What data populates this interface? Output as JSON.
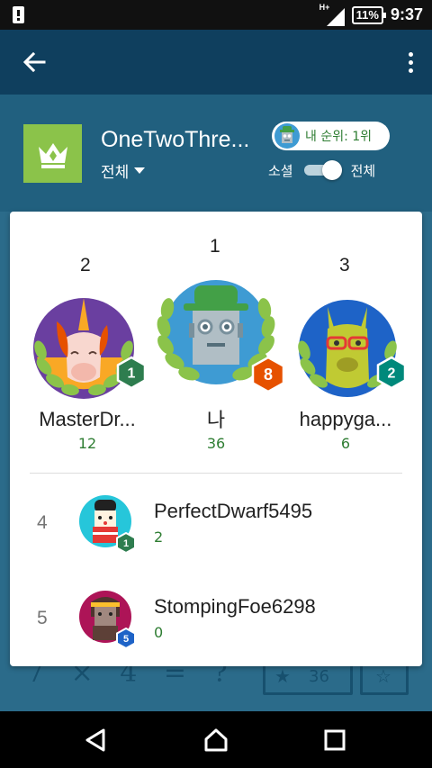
{
  "status_bar": {
    "network_label": "H+",
    "battery": "11%",
    "time": "9:37"
  },
  "app_bar": {
    "back_icon": "arrow-left-icon",
    "menu_icon": "more-vert-icon"
  },
  "header": {
    "title": "OneTwoThre...",
    "scope_selected": "전체",
    "my_rank_label": "내 순위: 1위",
    "toggle_left_label": "소셜",
    "toggle_right_label": "전체",
    "icon_color": "#8bc34a"
  },
  "podium": [
    {
      "rank": "2",
      "name": "MasterDr...",
      "score": "12",
      "level": "1",
      "badge_color": "#2e7d4f",
      "avatar": "unicorn-avatar"
    },
    {
      "rank": "1",
      "name": "나",
      "score": "36",
      "level": "8",
      "badge_color": "#e65100",
      "avatar": "robot-avatar"
    },
    {
      "rank": "3",
      "name": "happyga...",
      "score": "6",
      "level": "2",
      "badge_color": "#00897b",
      "avatar": "llama-avatar"
    }
  ],
  "list": [
    {
      "rank": "4",
      "name": "PerfectDwarf5495",
      "score": "2",
      "level": "1",
      "badge_color": "#2e7d4f",
      "avatar": "doll-avatar"
    },
    {
      "rank": "5",
      "name": "StompingFoe6298",
      "score": "0",
      "level": "5",
      "badge_color": "#1e63c7",
      "avatar": "warrior-avatar"
    }
  ],
  "background": {
    "equation": "7 × 4 = ?",
    "score_button": "36"
  }
}
